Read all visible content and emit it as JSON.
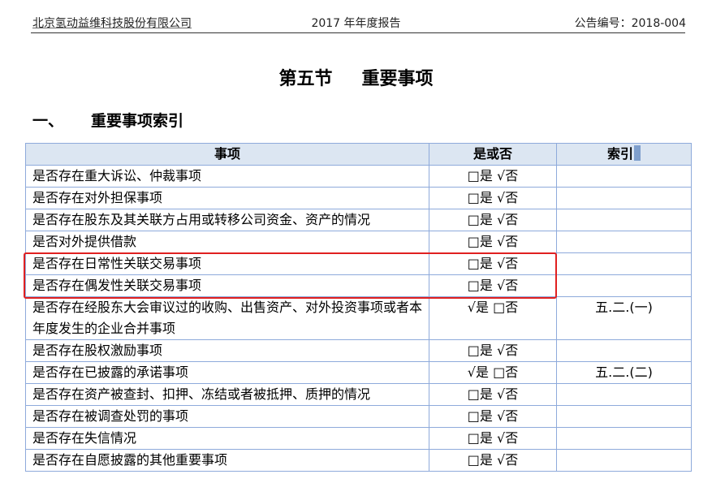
{
  "header": {
    "company": "北京氢动益维科技股份有限公司",
    "report": "2017 年年度报告",
    "announcement_no": "公告编号：2018-004"
  },
  "section": {
    "number": "第五节",
    "name": "重要事项"
  },
  "subsection": {
    "number": "一、",
    "name": "重要事项索引"
  },
  "table": {
    "columns": [
      "事项",
      "是或否",
      "索引"
    ],
    "rows": [
      {
        "item": "是否存在重大诉讼、仲裁事项",
        "answer": "□是 √否",
        "index": ""
      },
      {
        "item": "是否存在对外担保事项",
        "answer": "□是 √否",
        "index": ""
      },
      {
        "item": "是否存在股东及其关联方占用或转移公司资金、资产的情况",
        "answer": "□是 √否",
        "index": ""
      },
      {
        "item": "是否对外提供借款",
        "answer": "□是 √否",
        "index": ""
      },
      {
        "item": "是否存在日常性关联交易事项",
        "answer": "□是 √否",
        "index": ""
      },
      {
        "item": "是否存在偶发性关联交易事项",
        "answer": "□是 √否",
        "index": ""
      },
      {
        "item": "是否存在经股东大会审议过的收购、出售资产、对外投资事项或者本年度发生的企业合并事项",
        "answer": "√是 □否",
        "index": "五.二.(一)"
      },
      {
        "item": "是否存在股权激励事项",
        "answer": "□是 √否",
        "index": ""
      },
      {
        "item": "是否存在已披露的承诺事项",
        "answer": "√是 □否",
        "index": "五.二.(二)"
      },
      {
        "item": "是否存在资产被查封、扣押、冻结或者被抵押、质押的情况",
        "answer": "□是 √否",
        "index": ""
      },
      {
        "item": "是否存在被调查处罚的事项",
        "answer": "□是 √否",
        "index": ""
      },
      {
        "item": "是否存在失信情况",
        "answer": "□是 √否",
        "index": ""
      },
      {
        "item": "是否存在自愿披露的其他重要事项",
        "answer": "□是 √否",
        "index": ""
      }
    ]
  },
  "highlight_color": "#e02020"
}
